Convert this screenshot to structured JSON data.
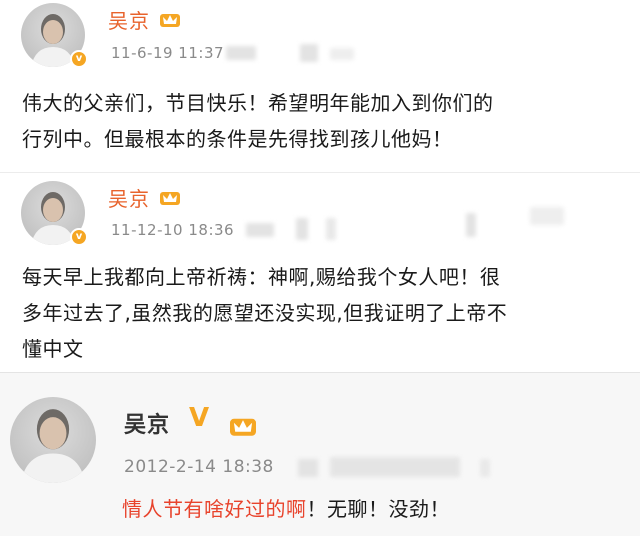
{
  "posts": [
    {
      "username": "吴京",
      "timestamp": "11-6-19 11:37",
      "verified_icon": "verified-v-icon",
      "level_icon": "crown-badge-icon",
      "text_lines": [
        "伟大的父亲们，节目快乐！希望明年能加入到你们的",
        "行列中。但最根本的条件是先得找到孩儿他妈！"
      ]
    },
    {
      "username": "吴京",
      "timestamp": "11-12-10 18:36",
      "verified_icon": "verified-v-icon",
      "level_icon": "crown-badge-icon",
      "text_lines": [
        "每天早上我都向上帝祈祷：神啊,赐给我个女人吧！很",
        "多年过去了,虽然我的愿望还没实现,但我证明了上帝不",
        "懂中文"
      ]
    },
    {
      "username": "吴京",
      "verified_mark": "V",
      "timestamp": "2012-2-14 18:38",
      "level_icon": "crown-badge-icon",
      "text_red": "情人节有啥好过的啊",
      "text_rest": "！无聊！没劲！"
    }
  ],
  "colors": {
    "username": "#e8632c",
    "accent_red": "#e8432c",
    "meta": "#8a8a8a",
    "badge": "#f5a623"
  }
}
